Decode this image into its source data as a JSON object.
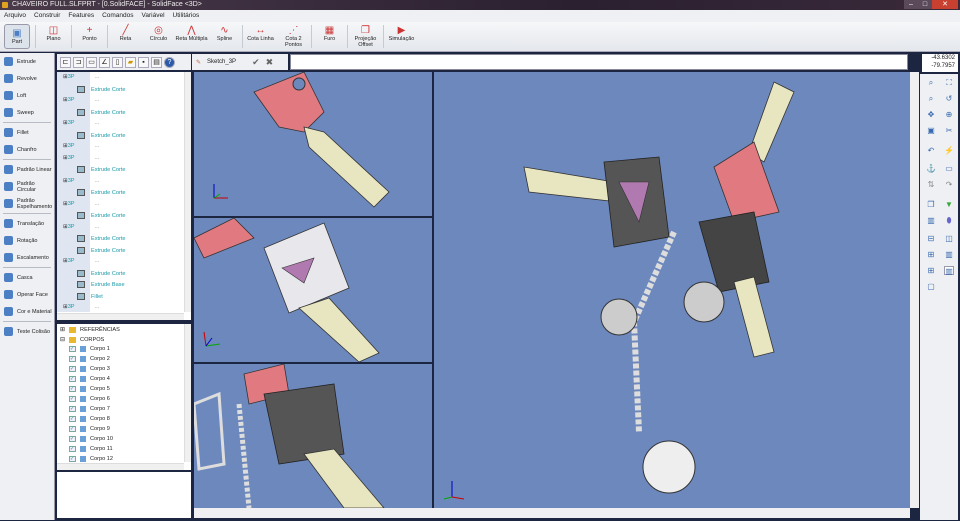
{
  "window": {
    "title": "CHAVEIRO FULL.SLFPRT - [0.SolidFACE] - SolidFace <3D>",
    "min": "–",
    "max": "□",
    "close": "✕"
  },
  "menu": [
    "Arquivo",
    "Construir",
    "Features",
    "Comandos",
    "Variável",
    "Utilitários"
  ],
  "toolbar": [
    {
      "label": "Plano",
      "icon": "plane-icon",
      "glyph": "◫"
    },
    {
      "label": "Ponto",
      "icon": "point-icon",
      "glyph": "+"
    },
    {
      "label": "Reta",
      "icon": "line-icon",
      "glyph": "╱"
    },
    {
      "label": "Círculo",
      "icon": "circle-icon",
      "glyph": "◎"
    },
    {
      "label": "Reta Múltipla",
      "icon": "polyline-icon",
      "glyph": "⋀"
    },
    {
      "label": "Spline",
      "icon": "spline-icon",
      "glyph": "∿"
    },
    {
      "label": "Cota Linha",
      "icon": "dimension-line-icon",
      "glyph": "↔"
    },
    {
      "label": "Cota 2 Pontos",
      "icon": "dimension-points-icon",
      "glyph": "⋰"
    },
    {
      "label": "Furo",
      "icon": "hole-icon",
      "glyph": "▦"
    },
    {
      "label": "Projeção Offset",
      "icon": "offset-projection-icon",
      "glyph": "❐"
    },
    {
      "label": "Simulação",
      "icon": "simulation-icon",
      "glyph": "▶"
    }
  ],
  "part_button": "Part",
  "commands": [
    "Extrude",
    "Revolve",
    "Loft",
    "Sweep",
    "|",
    "Fillet",
    "Chanfro",
    "|",
    "Padrão Linear",
    "Padrão Circular",
    "Padrão Espelhamento",
    "|",
    "Translação",
    "Rotação",
    "Escalamento",
    "|",
    "Casca",
    "Operar Face",
    "Cor e Material",
    "|",
    "Teste Colisão"
  ],
  "sketch": {
    "label": "Sketch_3P",
    "confirm": "✔",
    "cancel": "✖"
  },
  "coords": {
    "x": "-43.6302",
    "y": "-79.7957"
  },
  "tree": [
    {
      "t": "3P",
      "lvl": 0
    },
    {
      "t": "Extrude Corte",
      "lvl": 1
    },
    {
      "t": "3P",
      "lvl": 0
    },
    {
      "t": "Extrude Corte",
      "lvl": 1
    },
    {
      "t": "3P",
      "lvl": 0
    },
    {
      "t": "Extrude Corte",
      "lvl": 1
    },
    {
      "t": "3P",
      "lvl": 0
    },
    {
      "t": "3P",
      "lvl": 0
    },
    {
      "t": "Extrude Corte",
      "lvl": 1
    },
    {
      "t": "3P",
      "lvl": 0
    },
    {
      "t": "Extrude Corte",
      "lvl": 1
    },
    {
      "t": "3P",
      "lvl": 0
    },
    {
      "t": "Extrude Corte",
      "lvl": 1
    },
    {
      "t": "3P",
      "lvl": 0
    },
    {
      "t": "Extrude Corte",
      "lvl": 1
    },
    {
      "t": "Extrude Corte",
      "lvl": 1
    },
    {
      "t": "3P",
      "lvl": 0
    },
    {
      "t": "Extrude Corte",
      "lvl": 1
    },
    {
      "t": "Extrude Base",
      "lvl": 1
    },
    {
      "t": "Fillet",
      "lvl": 1
    },
    {
      "t": "3P",
      "lvl": 0
    }
  ],
  "bodies": {
    "references": "REFERÊNCIAS",
    "bodies": "CORPOS",
    "items": [
      "Corpo 1",
      "Corpo 2",
      "Corpo 3",
      "Corpo 4",
      "Corpo 5",
      "Corpo 6",
      "Corpo 7",
      "Corpo 8",
      "Corpo 9",
      "Corpo 10",
      "Corpo 11",
      "Corpo 12"
    ]
  },
  "colors": {
    "viewport": "#6d88bd",
    "key_red": "#e07a80",
    "key_brass": "#e8e6c0"
  }
}
